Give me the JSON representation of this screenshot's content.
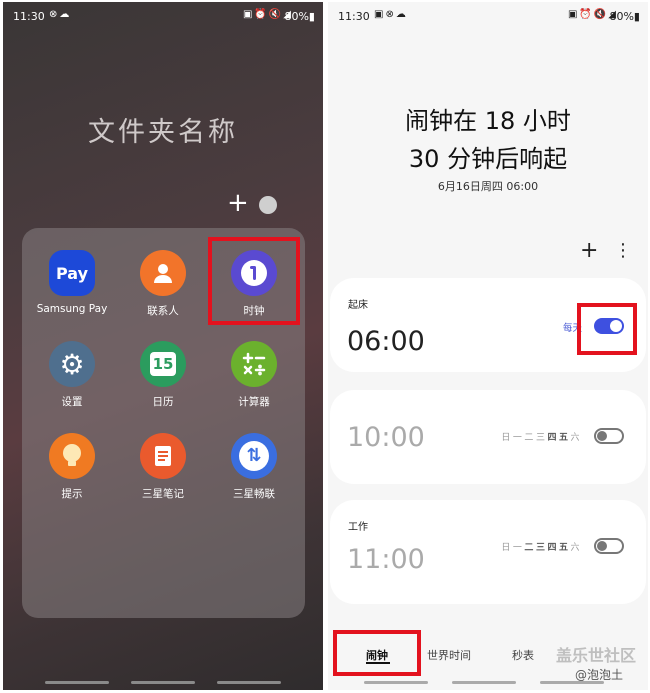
{
  "left": {
    "status": {
      "time": "11:30",
      "left_icons": "⊗☁",
      "right_icons": "▣⏰🔇◢",
      "battery": "80%▮"
    },
    "folder_name": "文件夹名称",
    "apps": [
      {
        "label": "Samsung Pay",
        "glyph": "Pay",
        "color": "#1d49d8",
        "icon": "samsung-pay-icon"
      },
      {
        "label": "联系人",
        "glyph": "👤",
        "color": "#f2742a",
        "icon": "contacts-icon"
      },
      {
        "label": "时钟",
        "glyph": "◔",
        "color": "#5a4ad1",
        "icon": "clock-icon"
      },
      {
        "label": "设置",
        "glyph": "⚙",
        "color": "#4f6f8e",
        "icon": "gear-icon"
      },
      {
        "label": "日历",
        "glyph": "15",
        "color": "#2b9c5e",
        "icon": "calendar-icon"
      },
      {
        "label": "计算器",
        "glyph": "±",
        "color": "#6bb12d",
        "icon": "calculator-icon"
      },
      {
        "label": "提示",
        "glyph": "💡",
        "color": "#f07a22",
        "icon": "tips-icon"
      },
      {
        "label": "三星笔记",
        "glyph": "✎",
        "color": "#ea5a2d",
        "icon": "notes-icon"
      },
      {
        "label": "三星畅联",
        "glyph": "⇅",
        "color": "#3a6ee0",
        "icon": "smart-switch-icon"
      }
    ]
  },
  "right": {
    "status": {
      "time": "11:30",
      "left_icons": "▣⊗☁",
      "right_icons": "▣⏰🔇◢",
      "battery": "80%▮"
    },
    "headline_line1": "闹钟在 18 小时",
    "headline_line2": "30 分钟后响起",
    "date": "6月16日周四 06:00",
    "toolbar": {
      "add": "+",
      "more": "⋮"
    },
    "alarms": [
      {
        "name": "起床",
        "time": "06:00",
        "repeat": "每天",
        "enabled": true
      },
      {
        "name": "",
        "time": "10:00",
        "days": [
          "日",
          "一",
          "二",
          "三",
          "四",
          "五",
          "六"
        ],
        "enabled": false
      },
      {
        "name": "工作",
        "time": "11:00",
        "days": [
          "日",
          "一",
          "二",
          "三",
          "四",
          "五",
          "六"
        ],
        "enabled": false
      }
    ],
    "tabs": [
      "闹钟",
      "世界时间",
      "秒表"
    ],
    "watermark_line1": "盖乐世社区",
    "watermark_line2": "@泡泡土"
  }
}
